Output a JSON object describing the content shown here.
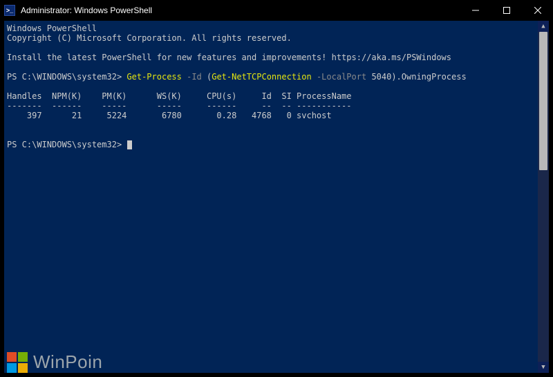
{
  "titlebar": {
    "icon_glyph": ">_",
    "title": "Administrator: Windows PowerShell"
  },
  "terminal": {
    "banner1": "Windows PowerShell",
    "banner2": "Copyright (C) Microsoft Corporation. All rights reserved.",
    "banner3": "Install the latest PowerShell for new features and improvements! https://aka.ms/PSWindows",
    "prompt1_prefix": "PS C:\\WINDOWS\\system32> ",
    "cmd1_part1": "Get-Process ",
    "cmd1_flag1": "-Id ",
    "cmd1_part2": "(",
    "cmd1_part3": "Get-NetTCPConnection ",
    "cmd1_flag2": "-LocalPort ",
    "cmd1_part4": "5040).OwningProcess",
    "table_header": "Handles  NPM(K)    PM(K)      WS(K)     CPU(s)     Id  SI ProcessName",
    "table_divider": "-------  ------    -----      -----     ------     --  -- -----------",
    "table_row1": "    397      21     5224       6780       0.28   4768   0 svchost",
    "prompt2_prefix": "PS C:\\WINDOWS\\system32> "
  },
  "watermark": {
    "text": "WinPoin"
  }
}
